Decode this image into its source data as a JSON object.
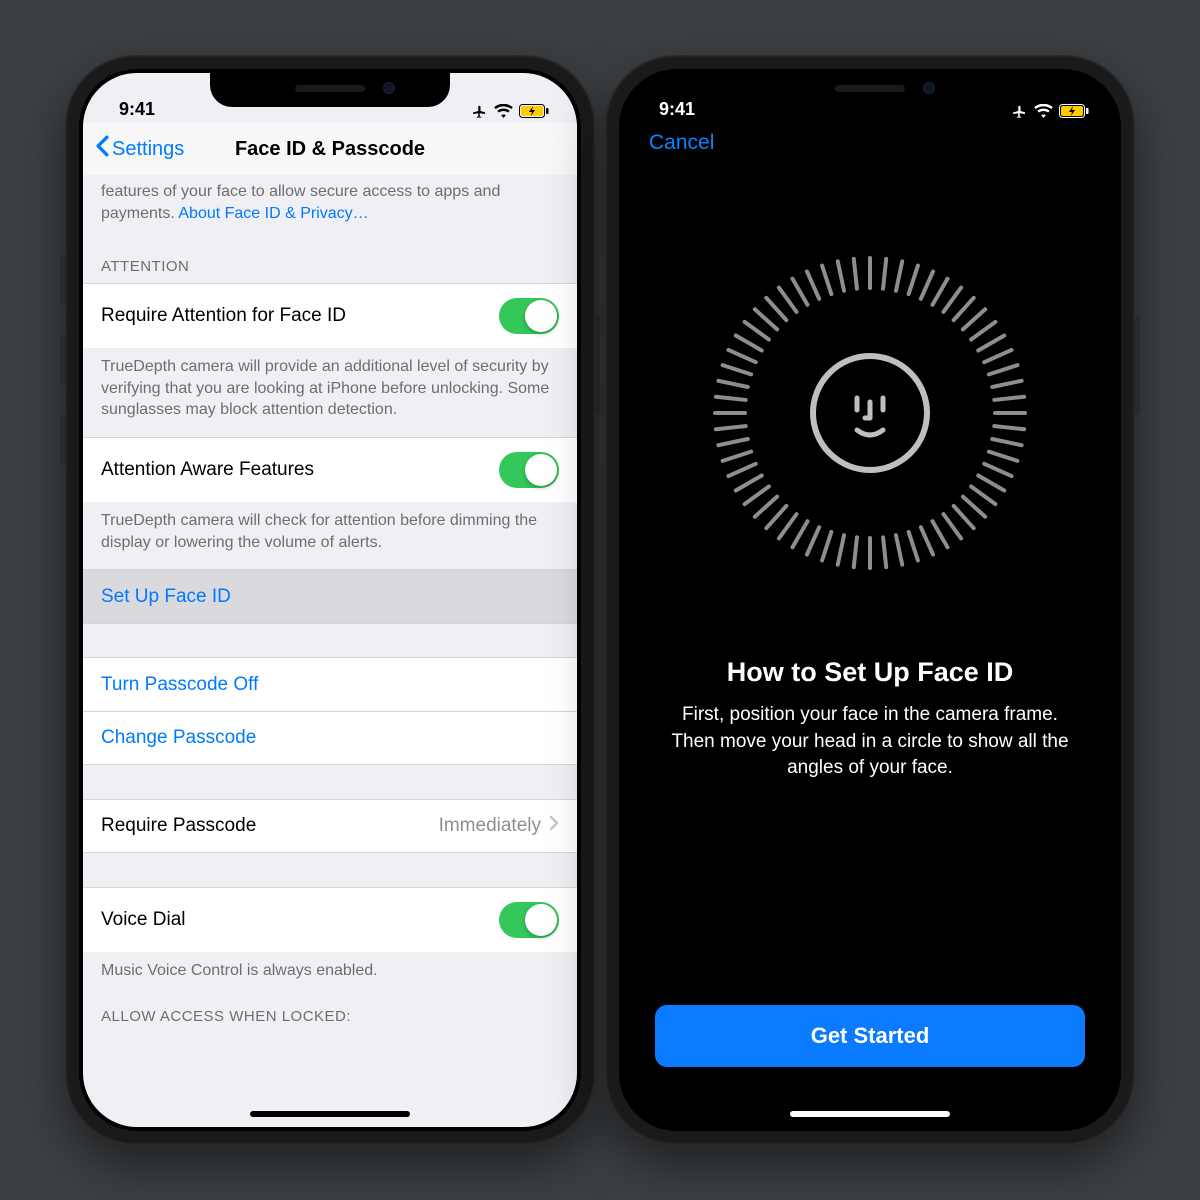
{
  "status": {
    "time": "9:41"
  },
  "left": {
    "back_label": "Settings",
    "title": "Face ID & Passcode",
    "intro_text": "features of your face to allow secure access to apps and payments. ",
    "intro_link": "About Face ID & Privacy…",
    "section_attention": "ATTENTION",
    "require_attention": {
      "label": "Require Attention for Face ID",
      "desc": "TrueDepth camera will provide an additional level of security by verifying that you are looking at iPhone before unlocking. Some sunglasses may block attention detection.",
      "on": true
    },
    "attention_aware": {
      "label": "Attention Aware Features",
      "desc": "TrueDepth camera will check for attention before dimming the display or lowering the volume of alerts.",
      "on": true
    },
    "setup_faceid": "Set Up Face ID",
    "turn_passcode_off": "Turn Passcode Off",
    "change_passcode": "Change Passcode",
    "require_passcode": {
      "label": "Require Passcode",
      "value": "Immediately"
    },
    "voice_dial": {
      "label": "Voice Dial",
      "desc": "Music Voice Control is always enabled.",
      "on": true
    },
    "section_allow": "ALLOW ACCESS WHEN LOCKED:"
  },
  "right": {
    "cancel": "Cancel",
    "title": "How to Set Up Face ID",
    "desc": "First, position your face in the camera frame. Then move your head in a circle to show all the angles of your face.",
    "cta": "Get Started"
  }
}
